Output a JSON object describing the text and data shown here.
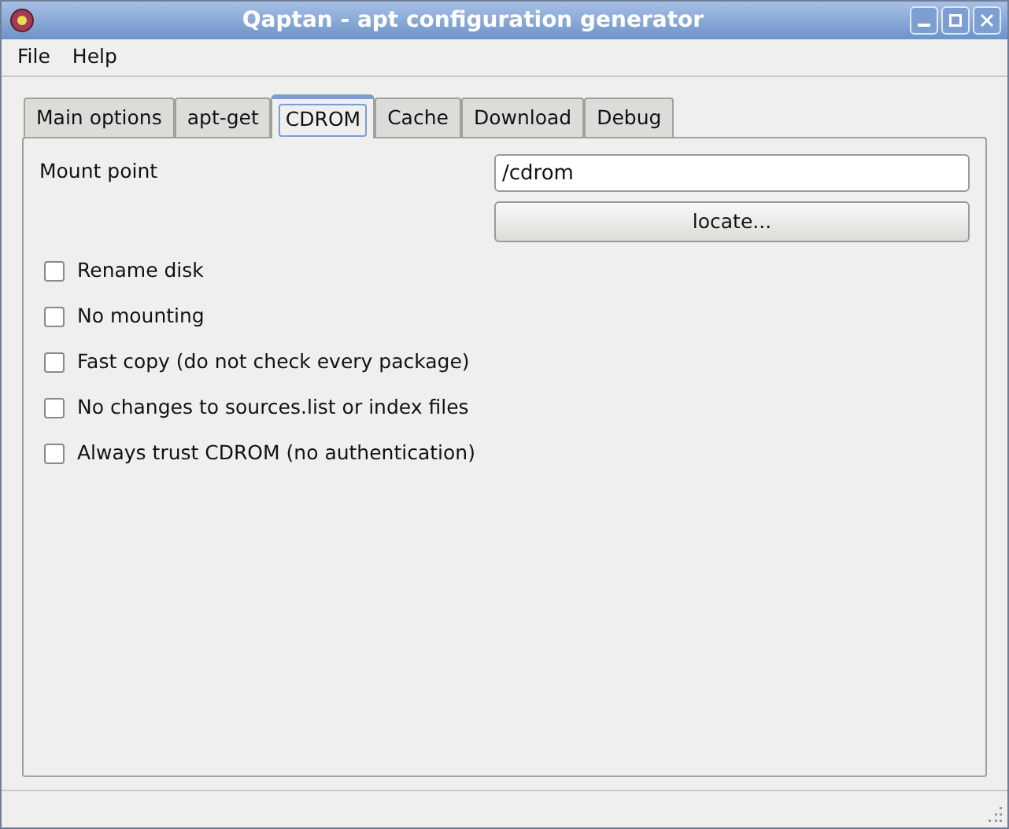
{
  "window": {
    "title": "Qaptan - apt configuration generator"
  },
  "menu": [
    "File",
    "Help"
  ],
  "tabs": [
    {
      "label": "Main options",
      "selected": false
    },
    {
      "label": "apt-get",
      "selected": false
    },
    {
      "label": "CDROM",
      "selected": true
    },
    {
      "label": "Cache",
      "selected": false
    },
    {
      "label": "Download",
      "selected": false
    },
    {
      "label": "Debug",
      "selected": false
    }
  ],
  "mount_point": {
    "label": "Mount point",
    "value": "/cdrom",
    "button": "locate..."
  },
  "options": [
    {
      "label": "Rename disk",
      "checked": false
    },
    {
      "label": "No mounting",
      "checked": false
    },
    {
      "label": "Fast copy (do not check every package)",
      "checked": false
    },
    {
      "label": "No changes to sources.list or index files",
      "checked": false
    },
    {
      "label": "Always trust CDROM (no authentication)",
      "checked": false
    }
  ]
}
